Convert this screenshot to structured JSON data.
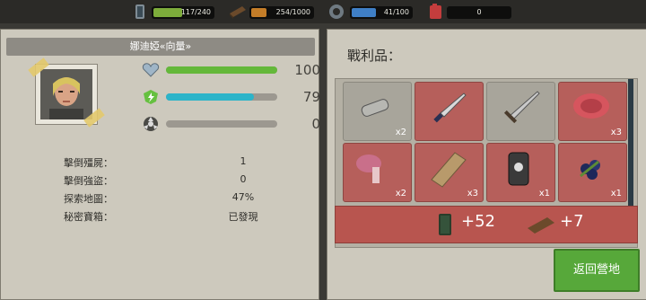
{
  "resources": {
    "battery": {
      "icon": "battery-icon",
      "text": "117/240",
      "fill": 0.4875,
      "color": "#7dac3b"
    },
    "wood": {
      "icon": "wood-plank-icon",
      "text": "254/1000",
      "fill": 0.254,
      "color": "#c47d28"
    },
    "gear": {
      "icon": "gear-icon",
      "text": "41/100",
      "fill": 0.41,
      "color": "#3f7fc6"
    },
    "fuel": {
      "icon": "fuel-can-icon",
      "text": "0",
      "fill": 0,
      "color": "#c43d3d"
    }
  },
  "character": {
    "name": "娜迪婭«向量»",
    "stats": [
      {
        "icon": "heart-icon",
        "value": "100",
        "fill": 1.0,
        "color": "#64b83a"
      },
      {
        "icon": "energy-icon",
        "value": "79",
        "fill": 0.79,
        "color": "#2cb4c9"
      },
      {
        "icon": "radiation-icon",
        "value": "0",
        "fill": 0,
        "color": "#999"
      }
    ]
  },
  "records": [
    {
      "label": "擊倒殭屍：",
      "value": "1"
    },
    {
      "label": "擊倒強盜：",
      "value": "0"
    },
    {
      "label": "探索地圖：",
      "value": "47%"
    },
    {
      "label": "秘密寶箱：",
      "value": "已發現"
    }
  ],
  "loot": {
    "title": "戰利品：",
    "items": [
      {
        "name": "pipe-icon",
        "count": "x2",
        "bg": "gray"
      },
      {
        "name": "knife-icon",
        "count": "",
        "bg": "red"
      },
      {
        "name": "sword-icon",
        "count": "",
        "bg": "gray"
      },
      {
        "name": "meat-icon",
        "count": "x3",
        "bg": "red"
      },
      {
        "name": "ham-icon",
        "count": "x2",
        "bg": "red"
      },
      {
        "name": "plank-icon",
        "count": "x3",
        "bg": "red"
      },
      {
        "name": "can-icon",
        "count": "x1",
        "bg": "red"
      },
      {
        "name": "berries-icon",
        "count": "x1",
        "bg": "red"
      }
    ]
  },
  "summary": {
    "items": [
      {
        "icon": "battery-icon",
        "value": "+52"
      },
      {
        "icon": "wood-plank-icon",
        "value": "+7"
      }
    ]
  },
  "return_label": "返回營地"
}
